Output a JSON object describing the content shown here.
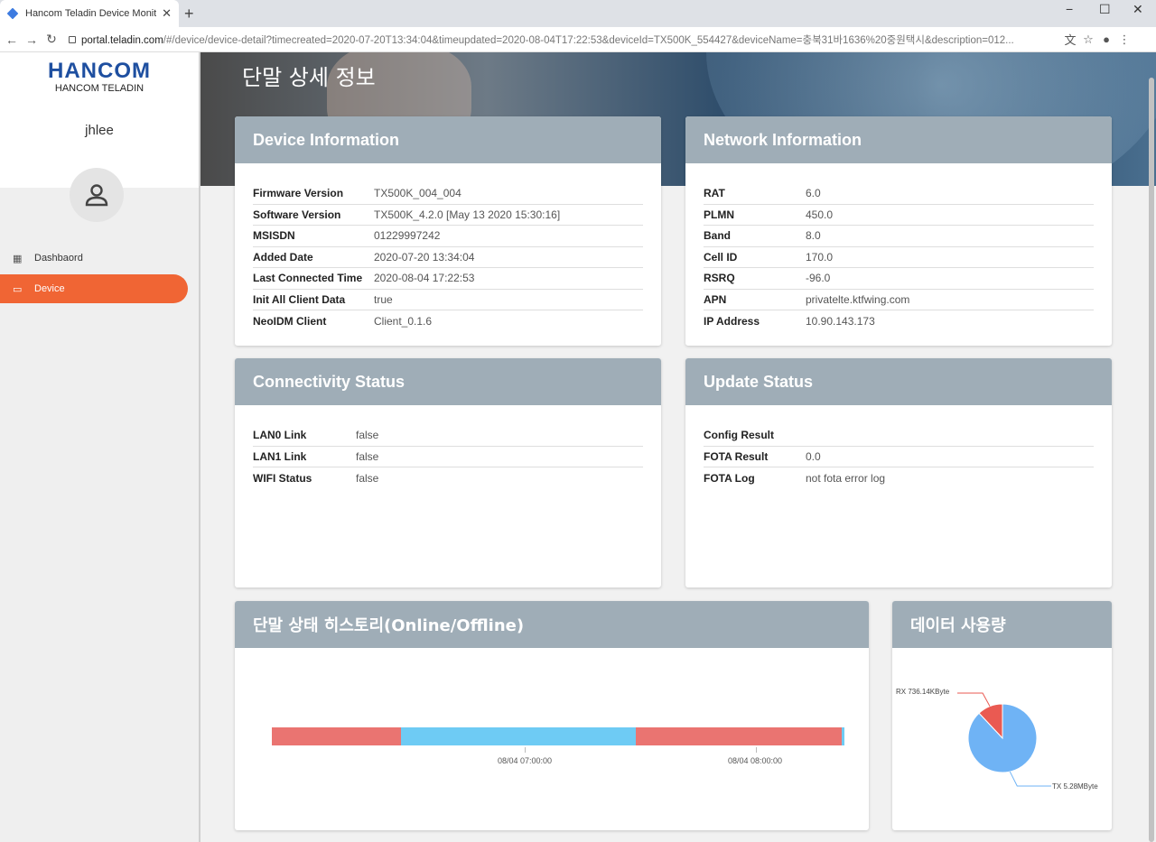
{
  "browser": {
    "tab_title": "Hancom Teladin Device Monitor",
    "url_host": "portal.teladin.com",
    "url_path": "/#/device/device-detail?timecreated=2020-07-20T13:34:04&timeupdated=2020-08-04T17:22:53&deviceId=TX500K_554427&deviceName=충북31바1636%20중원택시&description=012...",
    "new_tab": "+",
    "minimize": "−",
    "maximize": "☐",
    "close": "✕"
  },
  "sidebar": {
    "logo_mark": "HANCOM",
    "logo_sub": "HANCOM TELADIN",
    "username": "jhlee",
    "menu": [
      {
        "label": "Dashbaord",
        "icon": "dashboard-icon"
      },
      {
        "label": "Device",
        "icon": "device-icon"
      }
    ]
  },
  "main": {
    "title": "단말 상세 정보",
    "device_info": {
      "header": "Device Information",
      "rows": [
        {
          "k": "Firmware Version",
          "v": "TX500K_004_004"
        },
        {
          "k": "Software Version",
          "v": "TX500K_4.2.0 [May 13 2020 15:30:16]"
        },
        {
          "k": "MSISDN",
          "v": "01229997242"
        },
        {
          "k": "Added Date",
          "v": "2020-07-20 13:34:04"
        },
        {
          "k": "Last Connected Time",
          "v": "2020-08-04 17:22:53"
        },
        {
          "k": "Init All Client Data",
          "v": "true"
        },
        {
          "k": "NeoIDM Client",
          "v": "Client_0.1.6"
        }
      ]
    },
    "network_info": {
      "header": "Network Information",
      "rows": [
        {
          "k": "RAT",
          "v": "6.0"
        },
        {
          "k": "PLMN",
          "v": "450.0"
        },
        {
          "k": "Band",
          "v": "8.0"
        },
        {
          "k": "Cell ID",
          "v": "170.0"
        },
        {
          "k": "RSRQ",
          "v": "-96.0"
        },
        {
          "k": "APN",
          "v": "privatelte.ktfwing.com"
        },
        {
          "k": "IP Address",
          "v": "10.90.143.173"
        }
      ]
    },
    "connectivity": {
      "header": "Connectivity Status",
      "rows": [
        {
          "k": "LAN0 Link",
          "v": "false"
        },
        {
          "k": "LAN1 Link",
          "v": "false"
        },
        {
          "k": "WIFI Status",
          "v": "false"
        }
      ]
    },
    "update_status": {
      "header": "Update Status",
      "rows": [
        {
          "k": "Config Result",
          "v": ""
        },
        {
          "k": "FOTA Result",
          "v": "0.0"
        },
        {
          "k": "FOTA Log",
          "v": "not fota error log"
        }
      ]
    },
    "history": {
      "header": "단말 상태 히스토리(Online/Offline)",
      "ticks": [
        "08/04 07:00:00",
        "08/04 08:00:00"
      ],
      "segments": [
        {
          "state": "offline",
          "fraction": 0.225,
          "color": "#ea7471"
        },
        {
          "state": "online",
          "fraction": 0.41,
          "color": "#6ecbf4"
        },
        {
          "state": "offline",
          "fraction": 0.36,
          "color": "#ea7471"
        },
        {
          "state": "online",
          "fraction": 0.005,
          "color": "#6ecbf4"
        }
      ]
    },
    "data_usage": {
      "header": "데이터 사용량"
    }
  },
  "chart_data": {
    "type": "pie",
    "categories": [
      "RX",
      "TX"
    ],
    "values": [
      736.14,
      5406.72
    ],
    "labels": [
      "RX 736.14KByte",
      "TX 5.28MByte"
    ],
    "colors": [
      "#ea5a52",
      "#6fb3f5"
    ]
  }
}
